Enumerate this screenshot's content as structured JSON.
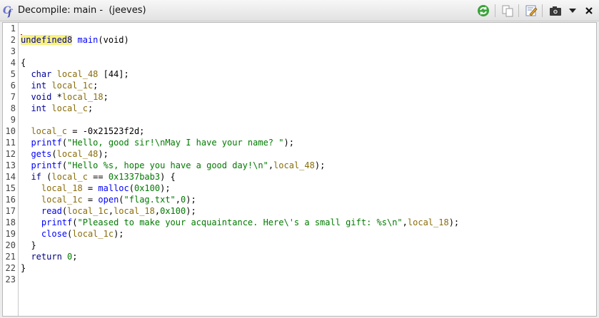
{
  "window": {
    "icon": "decompiler-cf-icon",
    "icon_text": "C",
    "icon_sub": "f",
    "title": "Decompile: main -  (jeeves)"
  },
  "toolbar": {
    "buttons": [
      {
        "name": "refresh-icon"
      },
      {
        "name": "copy-icon"
      },
      {
        "name": "edit-function-signature-icon"
      },
      {
        "name": "snapshot-camera-icon"
      },
      {
        "name": "menu-dropdown-icon"
      },
      {
        "name": "close-icon"
      }
    ]
  },
  "colors": {
    "keyword": "#000080",
    "type": "#0000a0",
    "function": "#0000ff",
    "variable": "#8a6d0b",
    "string": "#007a00",
    "highlight": "#f8f27a",
    "cursor": "#d00000"
  },
  "code": {
    "lines": [
      [],
      [
        {
          "t": "undefined8",
          "c": "ty hl",
          "cursor": true
        },
        {
          "t": " "
        },
        {
          "t": "main",
          "c": "fn"
        },
        {
          "t": "(void)"
        }
      ],
      [],
      [
        {
          "t": "{"
        }
      ],
      [
        {
          "t": "  "
        },
        {
          "t": "char",
          "c": "ty"
        },
        {
          "t": " "
        },
        {
          "t": "local_48",
          "c": "var"
        },
        {
          "t": " [44];"
        }
      ],
      [
        {
          "t": "  "
        },
        {
          "t": "int",
          "c": "ty"
        },
        {
          "t": " "
        },
        {
          "t": "local_1c",
          "c": "var"
        },
        {
          "t": ";"
        }
      ],
      [
        {
          "t": "  "
        },
        {
          "t": "void",
          "c": "ty"
        },
        {
          "t": " *"
        },
        {
          "t": "local_18",
          "c": "var"
        },
        {
          "t": ";"
        }
      ],
      [
        {
          "t": "  "
        },
        {
          "t": "int",
          "c": "ty"
        },
        {
          "t": " "
        },
        {
          "t": "local_c",
          "c": "var"
        },
        {
          "t": ";"
        }
      ],
      [],
      [
        {
          "t": "  "
        },
        {
          "t": "local_c",
          "c": "var"
        },
        {
          "t": " = -0x21523f2d;"
        }
      ],
      [
        {
          "t": "  "
        },
        {
          "t": "printf",
          "c": "fn"
        },
        {
          "t": "("
        },
        {
          "t": "\"Hello, good sir!\\nMay I have your name? \"",
          "c": "str"
        },
        {
          "t": ");"
        }
      ],
      [
        {
          "t": "  "
        },
        {
          "t": "gets",
          "c": "fn"
        },
        {
          "t": "("
        },
        {
          "t": "local_48",
          "c": "var"
        },
        {
          "t": ");"
        }
      ],
      [
        {
          "t": "  "
        },
        {
          "t": "printf",
          "c": "fn"
        },
        {
          "t": "("
        },
        {
          "t": "\"Hello %s, hope you have a good day!\\n\"",
          "c": "str"
        },
        {
          "t": ","
        },
        {
          "t": "local_48",
          "c": "var"
        },
        {
          "t": ");"
        }
      ],
      [
        {
          "t": "  "
        },
        {
          "t": "if",
          "c": "kw"
        },
        {
          "t": " ("
        },
        {
          "t": "local_c",
          "c": "var"
        },
        {
          "t": " == "
        },
        {
          "t": "0x1337bab3",
          "c": "num"
        },
        {
          "t": ") {"
        }
      ],
      [
        {
          "t": "    "
        },
        {
          "t": "local_18",
          "c": "var"
        },
        {
          "t": " = "
        },
        {
          "t": "malloc",
          "c": "fn"
        },
        {
          "t": "("
        },
        {
          "t": "0x100",
          "c": "num"
        },
        {
          "t": ");"
        }
      ],
      [
        {
          "t": "    "
        },
        {
          "t": "local_1c",
          "c": "var"
        },
        {
          "t": " = "
        },
        {
          "t": "open",
          "c": "fn"
        },
        {
          "t": "("
        },
        {
          "t": "\"flag.txt\"",
          "c": "str"
        },
        {
          "t": ","
        },
        {
          "t": "0",
          "c": "num"
        },
        {
          "t": ");"
        }
      ],
      [
        {
          "t": "    "
        },
        {
          "t": "read",
          "c": "fn"
        },
        {
          "t": "("
        },
        {
          "t": "local_1c",
          "c": "var"
        },
        {
          "t": ","
        },
        {
          "t": "local_18",
          "c": "var"
        },
        {
          "t": ","
        },
        {
          "t": "0x100",
          "c": "num"
        },
        {
          "t": ");"
        }
      ],
      [
        {
          "t": "    "
        },
        {
          "t": "printf",
          "c": "fn"
        },
        {
          "t": "("
        },
        {
          "t": "\"Pleased to make your acquaintance. Here\\'s a small gift: %s\\n\"",
          "c": "str"
        },
        {
          "t": ","
        },
        {
          "t": "local_18",
          "c": "var"
        },
        {
          "t": ");"
        }
      ],
      [
        {
          "t": "    "
        },
        {
          "t": "close",
          "c": "fn"
        },
        {
          "t": "("
        },
        {
          "t": "local_1c",
          "c": "var"
        },
        {
          "t": ");"
        }
      ],
      [
        {
          "t": "  }"
        }
      ],
      [
        {
          "t": "  "
        },
        {
          "t": "return",
          "c": "kw"
        },
        {
          "t": " "
        },
        {
          "t": "0",
          "c": "num"
        },
        {
          "t": ";"
        }
      ],
      [
        {
          "t": "}"
        }
      ],
      []
    ]
  }
}
